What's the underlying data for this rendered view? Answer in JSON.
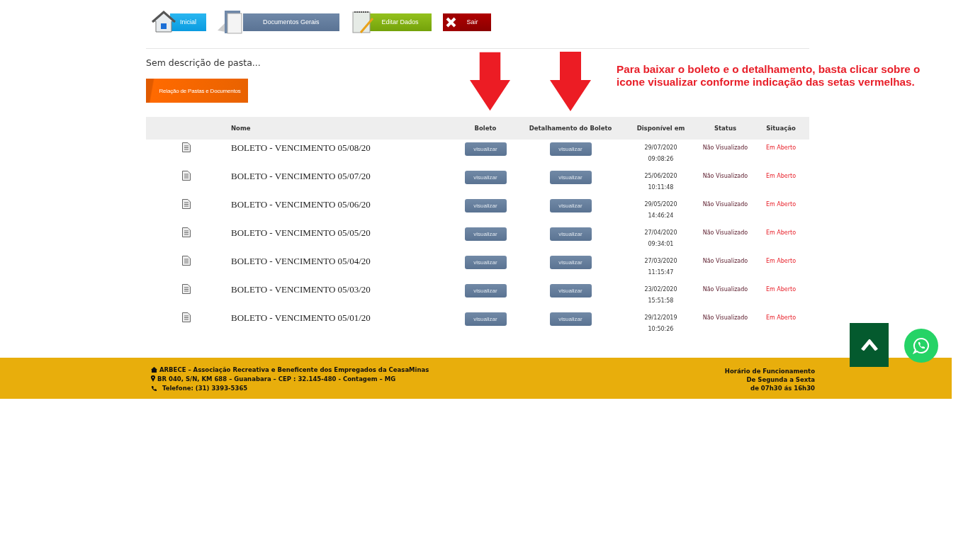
{
  "nav": [
    {
      "kind": "home",
      "label": "Inicial"
    },
    {
      "kind": "docs",
      "label": "Documentos Gerais"
    },
    {
      "kind": "edit",
      "label": "Editar Dados"
    },
    {
      "kind": "exit",
      "label": "Sair"
    }
  ],
  "folder_description": "Sem descrição de pasta...",
  "section_button": "Relação de Pastas e Documentos",
  "note": "Para baixar o boleto e o detalhamento, basta clicar sobre o icone visualizar conforme indicação das setas vermelhas.",
  "table": {
    "columns": [
      "Nome",
      "Boleto",
      "Detalhamento do Boleto",
      "Disponível em",
      "Status",
      "Situação"
    ],
    "rows": [
      {
        "name": "BOLETO - VENCIMENTO 05/08/20",
        "boleto": "visualizar",
        "detail": "visualizar",
        "date": "29/07/2020",
        "time": "09:08:26",
        "status": "Não Visualizado",
        "situation": "Em Aberto"
      },
      {
        "name": "BOLETO - VENCIMENTO 05/07/20",
        "boleto": "visualizar",
        "detail": "visualizar",
        "date": "25/06/2020",
        "time": "10:11:48",
        "status": "Não Visualizado",
        "situation": "Em Aberto"
      },
      {
        "name": "BOLETO - VENCIMENTO 05/06/20",
        "boleto": "visualizar",
        "detail": "visualizar",
        "date": "29/05/2020",
        "time": "14:46:24",
        "status": "Não Visualizado",
        "situation": "Em Aberto"
      },
      {
        "name": "BOLETO - VENCIMENTO 05/05/20",
        "boleto": "visualizar",
        "detail": "visualizar",
        "date": "27/04/2020",
        "time": "09:34:01",
        "status": "Não Visualizado",
        "situation": "Em Aberto"
      },
      {
        "name": "BOLETO - VENCIMENTO 05/04/20",
        "boleto": "visualizar",
        "detail": "visualizar",
        "date": "27/03/2020",
        "time": "11:15:47",
        "status": "Não Visualizado",
        "situation": "Em Aberto"
      },
      {
        "name": "BOLETO - VENCIMENTO 05/03/20",
        "boleto": "visualizar",
        "detail": "visualizar",
        "date": "23/02/2020",
        "time": "15:51:58",
        "status": "Não Visualizado",
        "situation": "Em Aberto"
      },
      {
        "name": "BOLETO - VENCIMENTO 05/01/20",
        "boleto": "visualizar",
        "detail": "visualizar",
        "date": "29/12/2019",
        "time": "10:50:26",
        "status": "Não Visualizado",
        "situation": "Em Aberto"
      }
    ]
  },
  "footer": {
    "left": [
      {
        "kind": "home",
        "text": "ARBECE – Associação Recreativa e Beneficente dos Empregados da CeasaMinas"
      },
      {
        "kind": "pin",
        "text": "BR 040, S/N, KM 688 – Guanabara – CEP : 32.145-480 - Contagem – MG"
      },
      {
        "kind": "phone",
        "text": "Telefone: (31) 3393-5365"
      }
    ],
    "right": [
      "Horário de Funcionamento",
      "De Segunda a Sexta",
      "de 07h30 ás 16h30"
    ]
  }
}
